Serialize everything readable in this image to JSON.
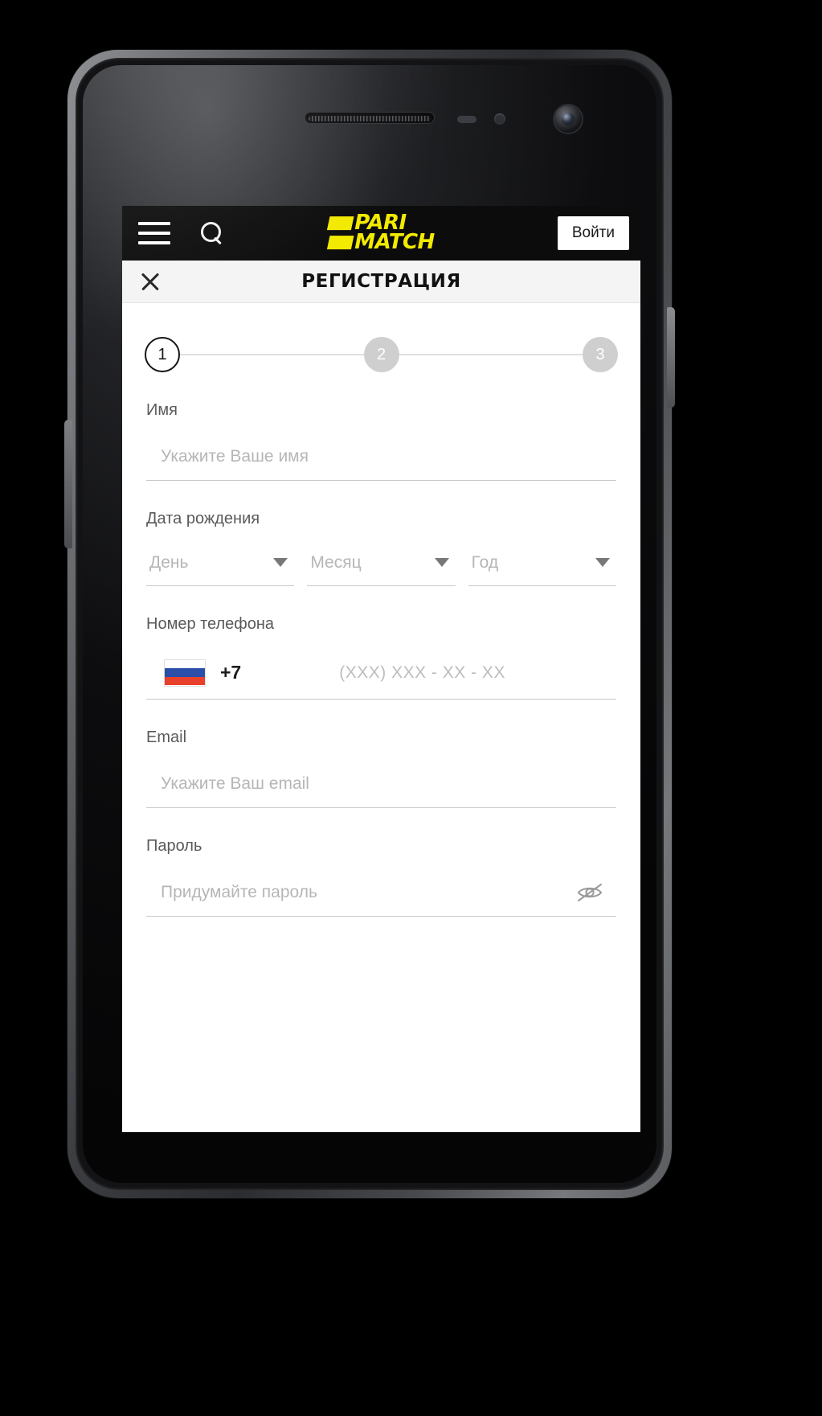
{
  "appbar": {
    "menu_icon": "hamburger-menu-icon",
    "search_icon": "search-icon",
    "brand_line1": "PARI",
    "brand_line2": "MATCH",
    "login_label": "Войти",
    "background": "#0c0c0c",
    "brand_color": "#f2ea00"
  },
  "modal": {
    "close_icon": "close-x-icon",
    "title": "РЕГИСТРАЦИЯ"
  },
  "stepper": {
    "steps": [
      {
        "number": "1",
        "state": "active"
      },
      {
        "number": "2",
        "state": "inactive"
      },
      {
        "number": "3",
        "state": "inactive"
      }
    ],
    "active_color": "#151515",
    "inactive_color": "#cfcfcf"
  },
  "form": {
    "name": {
      "label": "Имя",
      "placeholder": "Укажите Ваше имя",
      "value": ""
    },
    "birthdate": {
      "label": "Дата рождения",
      "day": {
        "placeholder": "День",
        "value": ""
      },
      "month": {
        "placeholder": "Месяц",
        "value": ""
      },
      "year": {
        "placeholder": "Год",
        "value": ""
      },
      "caret_icon": "chevron-down-icon"
    },
    "phone": {
      "label": "Номер телефона",
      "flag_icon": "russia-flag-icon",
      "dial_code": "+7",
      "placeholder": "(XXX) XXX - XX - XX",
      "value": ""
    },
    "email": {
      "label": "Email",
      "placeholder": "Укажите Ваш email",
      "value": ""
    },
    "password": {
      "label": "Пароль",
      "placeholder": "Придумайте пароль",
      "value": "",
      "toggle_icon": "eye-off-icon"
    }
  }
}
